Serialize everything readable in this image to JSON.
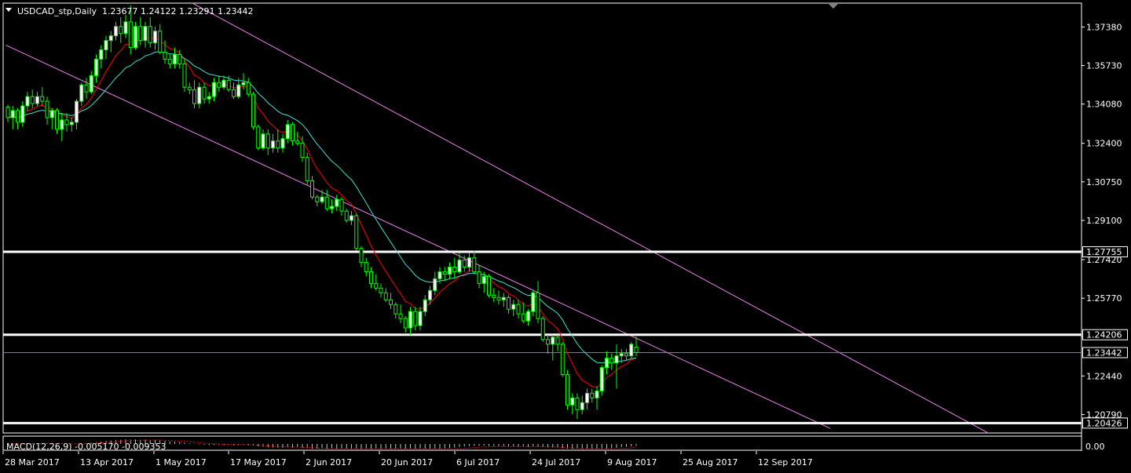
{
  "window": {
    "symbol_title": "USDCAD_stp,Daily",
    "ohlc": "1.23677 1.24122 1.23291 1.23442",
    "dropdown_icon": "triangle-down-icon"
  },
  "price_scale": {
    "labels": [
      "1.37380",
      "1.35730",
      "1.34080",
      "1.32400",
      "1.30750",
      "1.29100",
      "1.27420",
      "1.25770",
      "1.24120",
      "1.22440",
      "1.20790"
    ],
    "tagged": [
      {
        "label": "1.27755",
        "kind": "hline"
      },
      {
        "label": "1.24206",
        "kind": "hline"
      },
      {
        "label": "1.23442",
        "kind": "bid"
      },
      {
        "label": "1.20426",
        "kind": "hline"
      }
    ]
  },
  "macd": {
    "title": "MACD(12,26,9) -0.005170 -0.009353",
    "scale_label": "0.00"
  },
  "time_scale": {
    "labels": [
      "28 Mar 2017",
      "13 Apr 2017",
      "1 May 2017",
      "17 May 2017",
      "2 Jun 2017",
      "20 Jun 2017",
      "6 Jul 2017",
      "24 Jul 2017",
      "9 Aug 2017",
      "25 Aug 2017",
      "12 Sep 2017"
    ]
  },
  "colors": {
    "background": "#000000",
    "bull_candle": "#ffffff",
    "candle_outline": "#00ff00",
    "ma_fast": "#ff0000",
    "ma_slow": "#40e0d0",
    "channel": "#ee82ee",
    "hline": "#ffffff",
    "bid_line": "#708090",
    "macd_hist": "#c0c0c0",
    "macd_signal": "#ff0000"
  },
  "chart_data": {
    "type": "candlestick",
    "symbol": "USDCAD_stp",
    "timeframe": "Daily",
    "y_range": [
      1.2,
      1.384
    ],
    "last_ohlc": {
      "open": 1.23677,
      "high": 1.24122,
      "low": 1.23291,
      "close": 1.23442
    },
    "anchor_dates": [
      "28 Mar 2017",
      "13 Apr 2017",
      "1 May 2017",
      "17 May 2017",
      "2 Jun 2017",
      "20 Jun 2017",
      "6 Jul 2017",
      "24 Jul 2017",
      "9 Aug 2017",
      "25 Aug 2017",
      "12 Sep 2017"
    ],
    "candles": [
      [
        1.3395,
        1.3405,
        1.333,
        1.335
      ],
      [
        1.335,
        1.34,
        1.33,
        1.338
      ],
      [
        1.338,
        1.339,
        1.33,
        1.333
      ],
      [
        1.333,
        1.342,
        1.331,
        1.34
      ],
      [
        1.34,
        1.346,
        1.338,
        1.344
      ],
      [
        1.344,
        1.347,
        1.339,
        1.341
      ],
      [
        1.341,
        1.346,
        1.34,
        1.344
      ],
      [
        1.344,
        1.348,
        1.34,
        1.342
      ],
      [
        1.342,
        1.344,
        1.332,
        1.335
      ],
      [
        1.335,
        1.339,
        1.33,
        1.338
      ],
      [
        1.338,
        1.339,
        1.328,
        1.33
      ],
      [
        1.33,
        1.337,
        1.325,
        1.334
      ],
      [
        1.334,
        1.337,
        1.329,
        1.332
      ],
      [
        1.332,
        1.335,
        1.329,
        1.333
      ],
      [
        1.333,
        1.343,
        1.33,
        1.342
      ],
      [
        1.342,
        1.35,
        1.34,
        1.349
      ],
      [
        1.349,
        1.352,
        1.343,
        1.346
      ],
      [
        1.346,
        1.355,
        1.345,
        1.353
      ],
      [
        1.353,
        1.362,
        1.35,
        1.36
      ],
      [
        1.36,
        1.366,
        1.356,
        1.364
      ],
      [
        1.364,
        1.37,
        1.36,
        1.368
      ],
      [
        1.368,
        1.372,
        1.363,
        1.37
      ],
      [
        1.37,
        1.376,
        1.368,
        1.374
      ],
      [
        1.374,
        1.378,
        1.367,
        1.371
      ],
      [
        1.371,
        1.379,
        1.369,
        1.376
      ],
      [
        1.376,
        1.383,
        1.362,
        1.365
      ],
      [
        1.365,
        1.376,
        1.364,
        1.374
      ],
      [
        1.374,
        1.378,
        1.366,
        1.368
      ],
      [
        1.368,
        1.376,
        1.365,
        1.374
      ],
      [
        1.374,
        1.378,
        1.365,
        1.367
      ],
      [
        1.367,
        1.374,
        1.364,
        1.372
      ],
      [
        1.372,
        1.375,
        1.362,
        1.363
      ],
      [
        1.363,
        1.368,
        1.358,
        1.36
      ],
      [
        1.36,
        1.362,
        1.356,
        1.358
      ],
      [
        1.358,
        1.365,
        1.356,
        1.362
      ],
      [
        1.362,
        1.364,
        1.356,
        1.358
      ],
      [
        1.358,
        1.36,
        1.346,
        1.348
      ],
      [
        1.348,
        1.35,
        1.345,
        1.347
      ],
      [
        1.347,
        1.351,
        1.339,
        1.341
      ],
      [
        1.341,
        1.35,
        1.339,
        1.348
      ],
      [
        1.348,
        1.35,
        1.341,
        1.343
      ],
      [
        1.343,
        1.346,
        1.341,
        1.344
      ],
      [
        1.344,
        1.352,
        1.342,
        1.35
      ],
      [
        1.35,
        1.353,
        1.346,
        1.348
      ],
      [
        1.348,
        1.353,
        1.347,
        1.351
      ],
      [
        1.351,
        1.353,
        1.346,
        1.347
      ],
      [
        1.347,
        1.35,
        1.343,
        1.344
      ],
      [
        1.344,
        1.352,
        1.343,
        1.349
      ],
      [
        1.349,
        1.354,
        1.347,
        1.35
      ],
      [
        1.35,
        1.352,
        1.344,
        1.345
      ],
      [
        1.345,
        1.346,
        1.33,
        1.331
      ],
      [
        1.331,
        1.332,
        1.321,
        1.322
      ],
      [
        1.322,
        1.33,
        1.321,
        1.328
      ],
      [
        1.328,
        1.33,
        1.319,
        1.322
      ],
      [
        1.322,
        1.328,
        1.32,
        1.325
      ],
      [
        1.325,
        1.33,
        1.32,
        1.322
      ],
      [
        1.322,
        1.328,
        1.32,
        1.326
      ],
      [
        1.326,
        1.334,
        1.324,
        1.332
      ],
      [
        1.332,
        1.333,
        1.323,
        1.325
      ],
      [
        1.325,
        1.329,
        1.323,
        1.324
      ],
      [
        1.324,
        1.327,
        1.316,
        1.318
      ],
      [
        1.318,
        1.32,
        1.306,
        1.308
      ],
      [
        1.308,
        1.31,
        1.3,
        1.301
      ],
      [
        1.301,
        1.302,
        1.297,
        1.299
      ],
      [
        1.299,
        1.304,
        1.298,
        1.301
      ],
      [
        1.301,
        1.304,
        1.295,
        1.296
      ],
      [
        1.296,
        1.3,
        1.294,
        1.297
      ],
      [
        1.297,
        1.302,
        1.295,
        1.3
      ],
      [
        1.3,
        1.301,
        1.293,
        1.295
      ],
      [
        1.295,
        1.296,
        1.29,
        1.291
      ],
      [
        1.291,
        1.295,
        1.289,
        1.293
      ],
      [
        1.293,
        1.294,
        1.278,
        1.279
      ],
      [
        1.279,
        1.28,
        1.271,
        1.273
      ],
      [
        1.273,
        1.275,
        1.267,
        1.269
      ],
      [
        1.269,
        1.271,
        1.262,
        1.264
      ],
      [
        1.264,
        1.268,
        1.261,
        1.262
      ],
      [
        1.262,
        1.264,
        1.258,
        1.26
      ],
      [
        1.26,
        1.262,
        1.256,
        1.257
      ],
      [
        1.257,
        1.26,
        1.253,
        1.255
      ],
      [
        1.255,
        1.256,
        1.249,
        1.251
      ],
      [
        1.251,
        1.255,
        1.247,
        1.249
      ],
      [
        1.249,
        1.25,
        1.243,
        1.245
      ],
      [
        1.245,
        1.254,
        1.242,
        1.252
      ],
      [
        1.252,
        1.254,
        1.244,
        1.246
      ],
      [
        1.246,
        1.254,
        1.244,
        1.252
      ],
      [
        1.252,
        1.259,
        1.25,
        1.257
      ],
      [
        1.257,
        1.263,
        1.255,
        1.261
      ],
      [
        1.261,
        1.269,
        1.259,
        1.266
      ],
      [
        1.266,
        1.271,
        1.264,
        1.269
      ],
      [
        1.269,
        1.271,
        1.265,
        1.268
      ],
      [
        1.268,
        1.273,
        1.266,
        1.271
      ],
      [
        1.271,
        1.275,
        1.266,
        1.269
      ],
      [
        1.269,
        1.277,
        1.268,
        1.274
      ],
      [
        1.274,
        1.276,
        1.269,
        1.271
      ],
      [
        1.271,
        1.277,
        1.269,
        1.275
      ],
      [
        1.275,
        1.278,
        1.268,
        1.269
      ],
      [
        1.269,
        1.272,
        1.262,
        1.264
      ],
      [
        1.264,
        1.269,
        1.26,
        1.267
      ],
      [
        1.267,
        1.268,
        1.258,
        1.259
      ],
      [
        1.259,
        1.262,
        1.256,
        1.258
      ],
      [
        1.258,
        1.261,
        1.255,
        1.257
      ],
      [
        1.257,
        1.26,
        1.254,
        1.258
      ],
      [
        1.258,
        1.259,
        1.251,
        1.253
      ],
      [
        1.253,
        1.257,
        1.25,
        1.255
      ],
      [
        1.255,
        1.257,
        1.249,
        1.251
      ],
      [
        1.251,
        1.256,
        1.247,
        1.248
      ],
      [
        1.248,
        1.253,
        1.246,
        1.252
      ],
      [
        1.252,
        1.261,
        1.25,
        1.26
      ],
      [
        1.26,
        1.265,
        1.247,
        1.249
      ],
      [
        1.249,
        1.25,
        1.239,
        1.24
      ],
      [
        1.24,
        1.242,
        1.234,
        1.238
      ],
      [
        1.238,
        1.242,
        1.231,
        1.241
      ],
      [
        1.241,
        1.242,
        1.235,
        1.238
      ],
      [
        1.238,
        1.239,
        1.224,
        1.225
      ],
      [
        1.225,
        1.227,
        1.21,
        1.212
      ],
      [
        1.212,
        1.217,
        1.208,
        1.215
      ],
      [
        1.215,
        1.217,
        1.206,
        1.21
      ],
      [
        1.21,
        1.216,
        1.208,
        1.213
      ],
      [
        1.213,
        1.219,
        1.21,
        1.217
      ],
      [
        1.217,
        1.219,
        1.213,
        1.215
      ],
      [
        1.215,
        1.22,
        1.21,
        1.218
      ],
      [
        1.218,
        1.229,
        1.216,
        1.228
      ],
      [
        1.228,
        1.235,
        1.225,
        1.232
      ],
      [
        1.232,
        1.234,
        1.227,
        1.23
      ],
      [
        1.23,
        1.238,
        1.219,
        1.233
      ],
      [
        1.233,
        1.236,
        1.23,
        1.234
      ],
      [
        1.234,
        1.236,
        1.231,
        1.233
      ],
      [
        1.233,
        1.239,
        1.232,
        1.238
      ],
      [
        1.23677,
        1.24122,
        1.23291,
        1.23442
      ]
    ],
    "hlines": [
      1.27755,
      1.24206,
      1.20426
    ],
    "bid": 1.23442,
    "trendlines": [
      {
        "name": "channel-upper",
        "p1": [
          "2 May 2017",
          1.384
        ],
        "p2": [
          "12 Oct 2017",
          1.199
        ]
      },
      {
        "name": "channel-lower",
        "p1": [
          "24 Mar 2017",
          1.366
        ],
        "p2": [
          "18 Sep 2017",
          1.202
        ]
      }
    ],
    "moving_averages": [
      {
        "name": "fast",
        "color": "#ff0000",
        "period_note": ""
      },
      {
        "name": "slow",
        "color": "#40e0d0",
        "period_note": ""
      }
    ],
    "macd": {
      "main": -0.00517,
      "signal": -0.009353
    }
  }
}
